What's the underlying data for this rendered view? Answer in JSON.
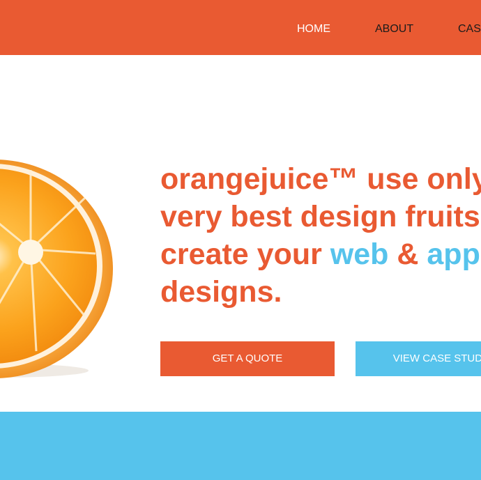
{
  "nav": {
    "items": [
      "HOME",
      "ABOUT",
      "CAS"
    ]
  },
  "hero": {
    "image_icon": "orange-half-icon",
    "headline": {
      "brand_bold": "orange",
      "brand_rest": "juice™ use only",
      "line2": "very best design fruits t",
      "line3_pre": "create your ",
      "line3_web": "web",
      "line3_amp": " & ",
      "line3_app": "app",
      "line4": "designs."
    },
    "buttons": {
      "quote": "GET A QUOTE",
      "cases": "VIEW CASE STUDIE"
    }
  },
  "colors": {
    "orange": "#e95a32",
    "blue": "#56c3ec"
  }
}
